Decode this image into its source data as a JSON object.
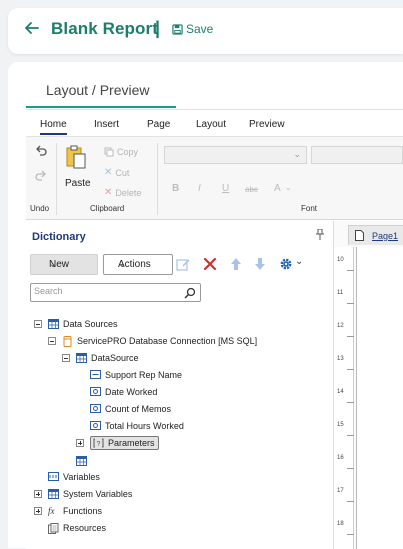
{
  "header": {
    "title": "Blank Report",
    "separator": "|",
    "save_label": "Save"
  },
  "main_tab": {
    "label": "Layout / Preview"
  },
  "ribbon": {
    "tabs": [
      "Home",
      "Insert",
      "Page",
      "Layout",
      "Preview"
    ],
    "active_tab": "Home",
    "undo_label": "Undo",
    "clipboard_label": "Clipboard",
    "font_label": "Font",
    "paste_label": "Paste",
    "copy_label": "Copy",
    "cut_label": "Cut",
    "delete_label": "Delete",
    "format_buttons": [
      "B",
      "I",
      "U",
      "abc",
      "A"
    ]
  },
  "dictionary": {
    "title": "Dictionary",
    "new_label": "New",
    "actions_label": "Actions",
    "search_placeholder": "Search",
    "tree": {
      "data_sources": "Data Sources",
      "connection": "ServicePRO Database Connection [MS SQL]",
      "datasource": "DataSource",
      "fields": [
        "Support Rep Name",
        "Date Worked",
        "Count of Memos",
        "Total Hours Worked"
      ],
      "parameters": "Parameters",
      "variables": "Variables",
      "system_variables": "System Variables",
      "functions": "Functions",
      "resources": "Resources"
    }
  },
  "report_page": {
    "tab_label": "Page1",
    "ruler_numbers": [
      "10",
      "11",
      "12",
      "13",
      "14",
      "15",
      "16",
      "17",
      "18"
    ]
  },
  "colors": {
    "brand": "#1b7f6b",
    "accent_underline": "#1b9b83",
    "navy": "#1f3a7a",
    "delete_red": "#d32f2f",
    "gear_blue": "#1e63b5"
  }
}
